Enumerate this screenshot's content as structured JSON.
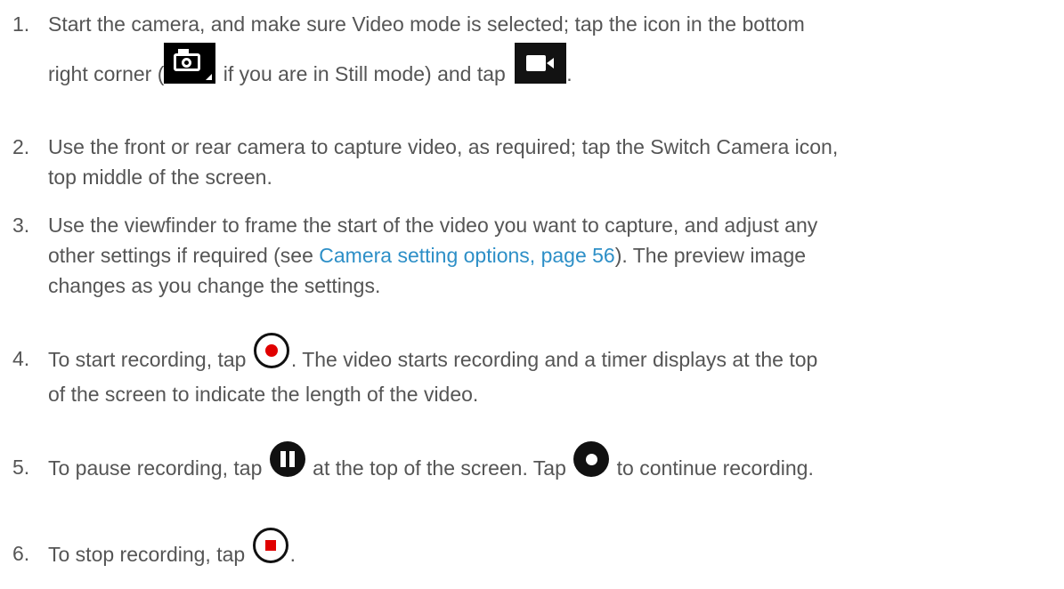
{
  "steps": [
    {
      "num": "1.",
      "a": "Start the camera, and make sure Video mode is selected; tap the icon in the bottom",
      "b": "right corner (",
      "c": "if you are in Still mode) and tap",
      "d": "."
    },
    {
      "num": "2.",
      "a": "Use the front or rear camera to capture video, as required; tap the Switch Camera icon,",
      "b": "top middle of the screen."
    },
    {
      "num": "3.",
      "a": "Use the viewfinder to frame the start of the video you want to capture, and adjust any",
      "b": "other settings if required (see ",
      "link": "Camera setting options, page 56",
      "c": "). The preview image",
      "d": "changes as you change the settings."
    },
    {
      "num": "4.",
      "a": "To start recording, tap",
      "b": ". The video starts recording and a timer displays at the top",
      "c": "of the screen to indicate the length of the video."
    },
    {
      "num": "5.",
      "a": "To pause recording, tap",
      "b": "at the top of the screen. Tap",
      "c": "to continue recording."
    },
    {
      "num": "6.",
      "a": "To stop recording, tap",
      "b": "."
    }
  ],
  "icons": {
    "still_mode": "still-camera-icon",
    "video_mode": "video-camera-icon",
    "record": "record-icon",
    "pause": "pause-icon",
    "resume": "resume-record-icon",
    "stop": "stop-icon"
  },
  "colors": {
    "text": "#555555",
    "link": "#2d8fc7",
    "record_red": "#e00000"
  }
}
